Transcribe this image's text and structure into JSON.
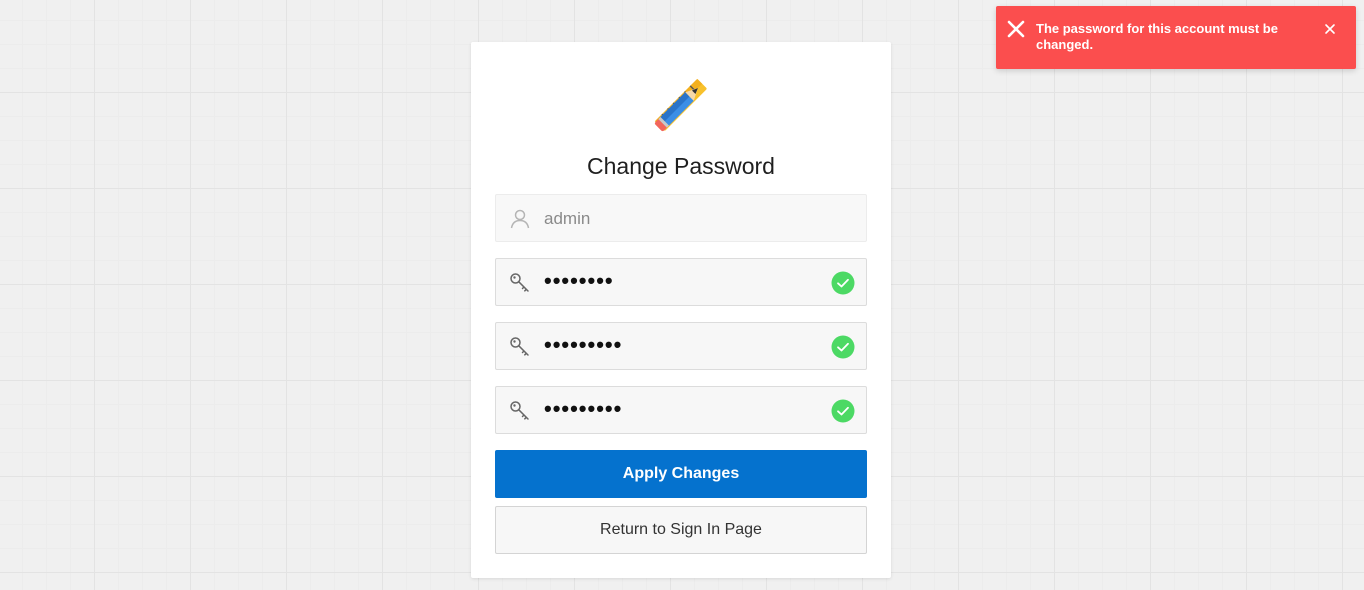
{
  "notification": {
    "message": "The password for this account must be changed.",
    "color": "#fb4e4e"
  },
  "page": {
    "title": "Change Password"
  },
  "fields": {
    "username": {
      "value": "admin",
      "icon": "user-icon"
    },
    "current_password": {
      "value": "••••••••",
      "icon": "key-icon",
      "status": "valid"
    },
    "new_password": {
      "value": "•••••••••",
      "icon": "key-icon",
      "status": "valid"
    },
    "confirm_password": {
      "value": "•••••••••",
      "icon": "key-icon",
      "status": "valid"
    }
  },
  "buttons": {
    "apply": "Apply Changes",
    "return": "Return to Sign In Page"
  },
  "colors": {
    "primary": "#0572ce",
    "success": "#4cd964",
    "error": "#fb4e4e"
  }
}
